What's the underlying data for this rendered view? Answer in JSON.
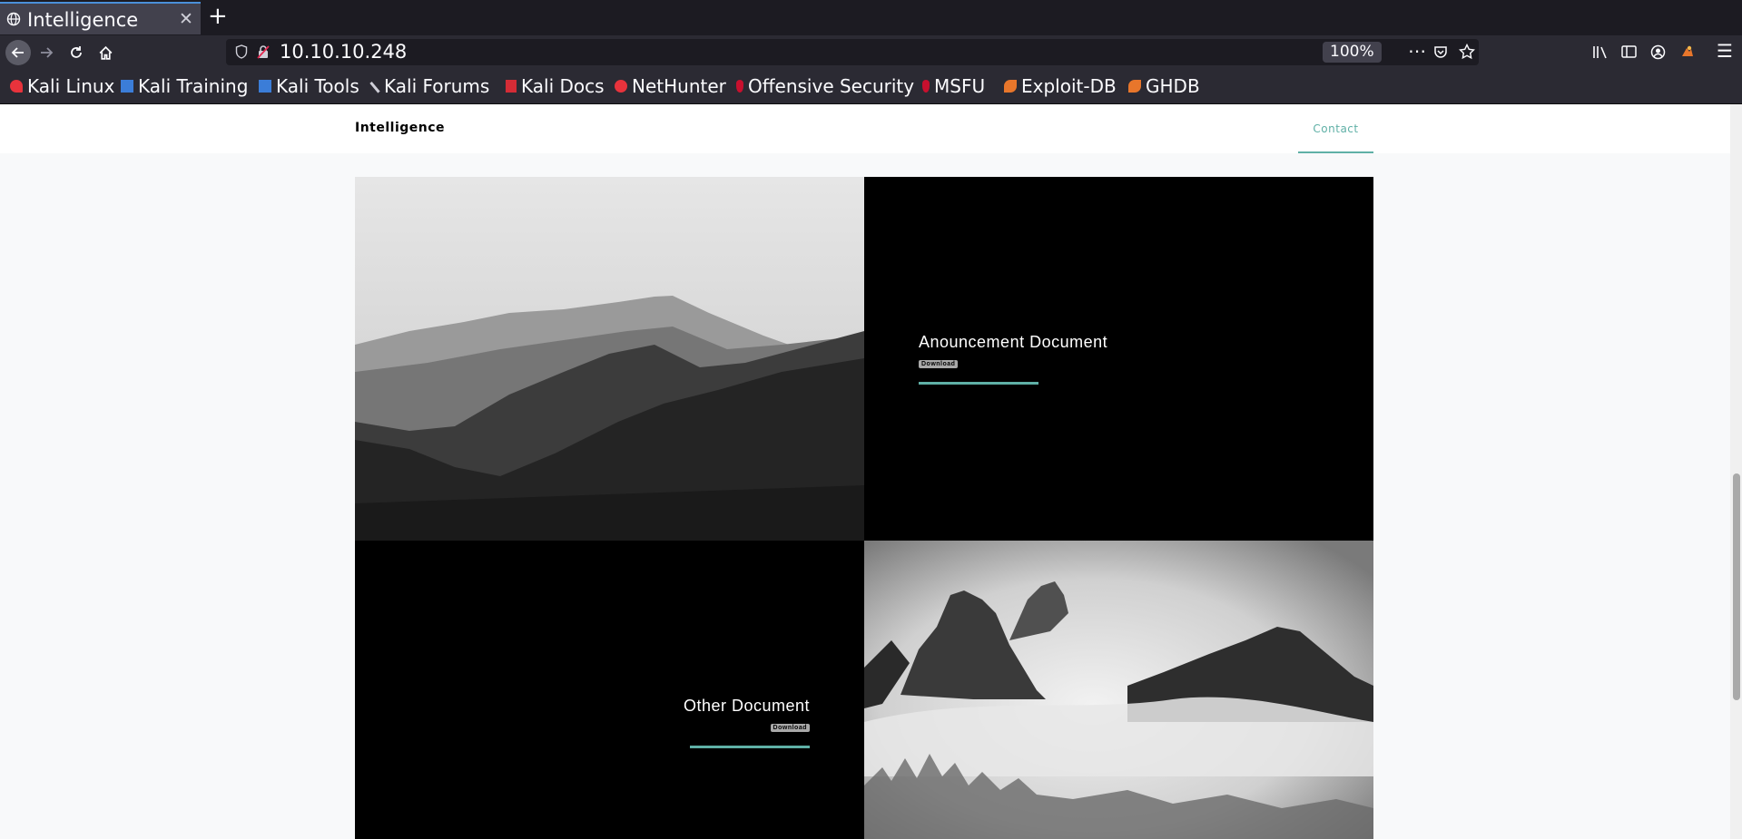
{
  "browser": {
    "tab_title": "Intelligence",
    "url": "10.10.10.248",
    "zoom": "100%",
    "bookmarks": [
      {
        "label": "Kali Linux",
        "icon": "kali-dragon-icon"
      },
      {
        "label": "Kali Training",
        "icon": "kali-training-icon"
      },
      {
        "label": "Kali Tools",
        "icon": "kali-tools-icon"
      },
      {
        "label": "Kali Forums",
        "icon": "kali-forums-icon"
      },
      {
        "label": "Kali Docs",
        "icon": "kali-docs-icon"
      },
      {
        "label": "NetHunter",
        "icon": "nethunter-icon"
      },
      {
        "label": "Offensive Security",
        "icon": "offsec-icon"
      },
      {
        "label": "MSFU",
        "icon": "msfu-icon"
      },
      {
        "label": "Exploit-DB",
        "icon": "exploit-db-icon"
      },
      {
        "label": "GHDB",
        "icon": "ghdb-icon"
      }
    ]
  },
  "site": {
    "brand": "Intelligence",
    "nav_contact": "Contact",
    "documents": [
      {
        "title": "Anouncement Document",
        "button": "Download"
      },
      {
        "title": "Other Document",
        "button": "Download"
      }
    ]
  },
  "colors": {
    "accent": "#5fb0a6",
    "browser_bg": "#1c1b22",
    "toolbar_bg": "#2b2a33",
    "page_bg": "#f8f9fa"
  }
}
